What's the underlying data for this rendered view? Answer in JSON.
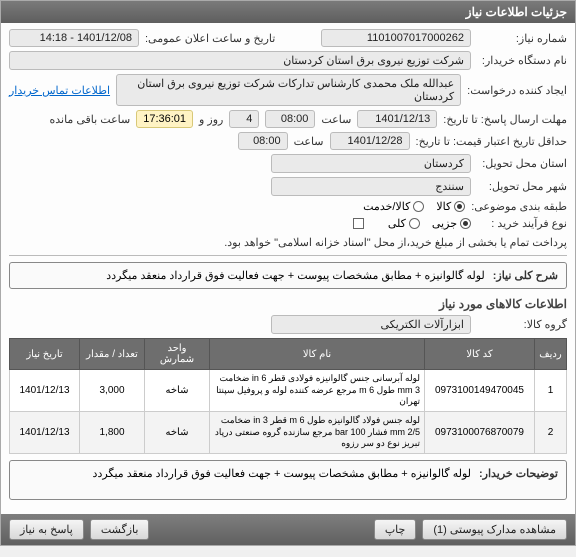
{
  "titlebar": "جزئیات اطلاعات نیاز",
  "fields": {
    "need_no_label": "شماره نیاز:",
    "need_no": "1101007017000262",
    "announce_label": "تاریخ و ساعت اعلان عمومی:",
    "announce_val": "1401/12/08 - 14:18",
    "buyer_label": "نام دستگاه خریدار:",
    "buyer_val": "شرکت توزیع نیروی برق استان کردستان",
    "creator_label": "ایجاد کننده درخواست:",
    "creator_val": "عبدالله ملک محمدی کارشناس تدارکات شرکت توزیع نیروی برق استان کردستان",
    "contact_link": "اطلاعات تماس خریدار",
    "deadline_reply_label": "مهلت ارسال پاسخ: تا تاریخ:",
    "deadline_reply_date": "1401/12/13",
    "saat": "ساعت",
    "deadline_reply_time": "08:00",
    "days_remaining": "4",
    "rooz_va": "روز و",
    "countdown": "17:36:01",
    "remain_suffix": "ساعت باقی مانده",
    "validity_label": "حداقل تاریخ اعتبار قیمت: تا تاریخ:",
    "validity_date": "1401/12/28",
    "validity_time": "08:00",
    "province_label": "استان محل تحویل:",
    "province_val": "کردستان",
    "city_label": "شهر محل تحویل:",
    "city_val": "سنندج",
    "category_label": "طبقه بندی موضوعی:",
    "cat_kala": "کالا",
    "cat_khadamat": "کالا/خدمت",
    "process_label": "نوع فرآیند خرید :",
    "proc_joz": "جزیی",
    "proc_kol": "کلی",
    "payment_note": "پرداخت تمام یا بخشی از مبلغ خرید،از محل \"اسناد خزانه اسلامی\" خواهد بود."
  },
  "desc": {
    "label": "شرح کلی نیاز:",
    "text": "لوله گالوانیزه + مطابق مشخصات پیوست + جهت فعالیت فوق قرارداد منعقد میگردد"
  },
  "items_section": "اطلاعات کالاهای مورد نیاز",
  "group_label": "گروه کالا:",
  "group_val": "ابزارآلات الکتریکی",
  "table": {
    "headers": [
      "ردیف",
      "کد کالا",
      "نام کالا",
      "واحد شمارش",
      "تعداد / مقدار",
      "تاریخ نیاز"
    ],
    "rows": [
      {
        "idx": "1",
        "code": "0973100149470045",
        "name": "لوله آبرسانی جنس گالوانیزه فولادی قطر 6 in ضخامت 3 mm طول 6 m مرجع عرضه کننده لوله و پروفیل سپنتا تهران",
        "unit": "شاخه",
        "qty": "3,000",
        "date": "1401/12/13"
      },
      {
        "idx": "2",
        "code": "0973100076870079",
        "name": "لوله جنس فولاد گالوانیزه طول 6 m قطر 3 in ضخامت 2/5 mm فشار 100 bar مرجع سازنده گروه صنعتی درپاد تبریز نوع دو سر رزوه",
        "unit": "شاخه",
        "qty": "1,800",
        "date": "1401/12/13"
      }
    ]
  },
  "notes_label": "توضیحات خریدار:",
  "notes_text": "لوله گالوانیزه + مطابق مشخصات پیوست + جهت فعالیت فوق قرارداد منعقد میگردد",
  "footer": {
    "attachments": "مشاهده مدارک پیوستی (1)",
    "print": "چاپ",
    "back": "بازگشت",
    "reply": "پاسخ به نیاز"
  }
}
